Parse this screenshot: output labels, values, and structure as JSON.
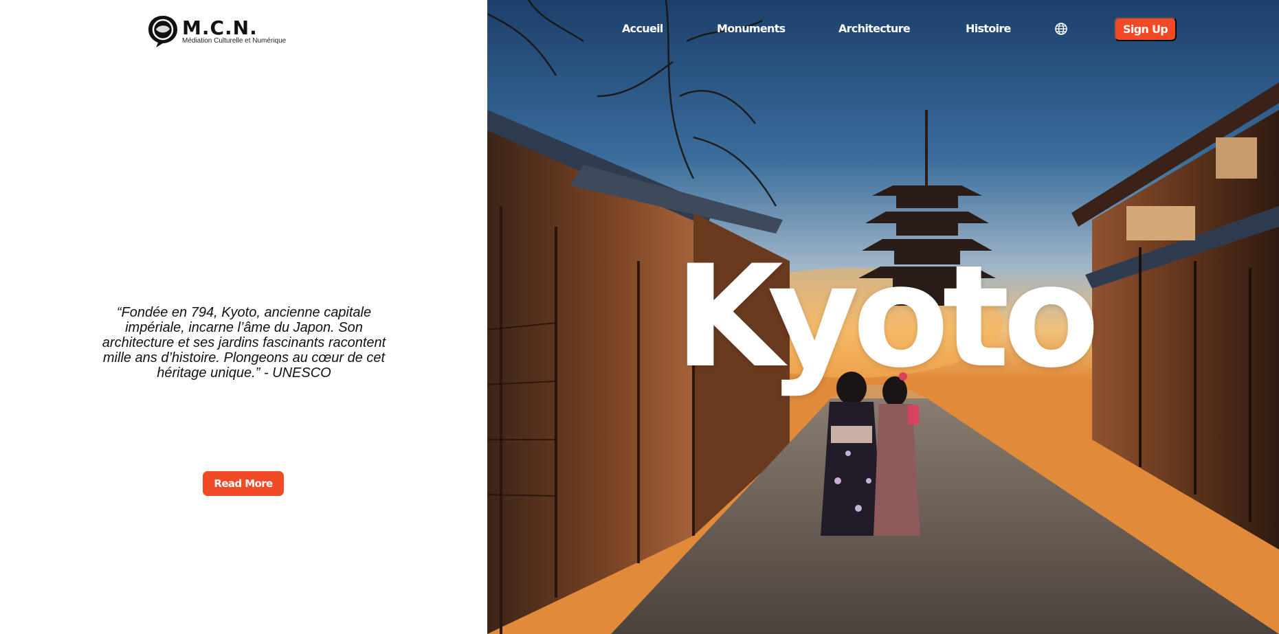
{
  "brand": {
    "name": "M.C.N.",
    "tagline": "Médiation Culturelle et Numérique"
  },
  "nav": {
    "items": [
      {
        "label": "Accueil"
      },
      {
        "label": "Monuments"
      },
      {
        "label": "Architecture"
      },
      {
        "label": "Histoire"
      }
    ],
    "globe_icon": "globe-icon",
    "signup_label": "Sign Up"
  },
  "hero": {
    "title": "Kyoto"
  },
  "quote": {
    "text": "“Fondée en 794, Kyoto, ancienne capitale impériale, incarne l’âme du Japon. Son architecture et ses jardins fascinants racontent mille ans d’histoire. Plongeons au cœur de cet héritage unique.” - UNESCO"
  },
  "cta": {
    "read_more_label": "Read More"
  },
  "colors": {
    "accent": "#f24a26",
    "text_dark": "#111111",
    "white": "#ffffff"
  }
}
